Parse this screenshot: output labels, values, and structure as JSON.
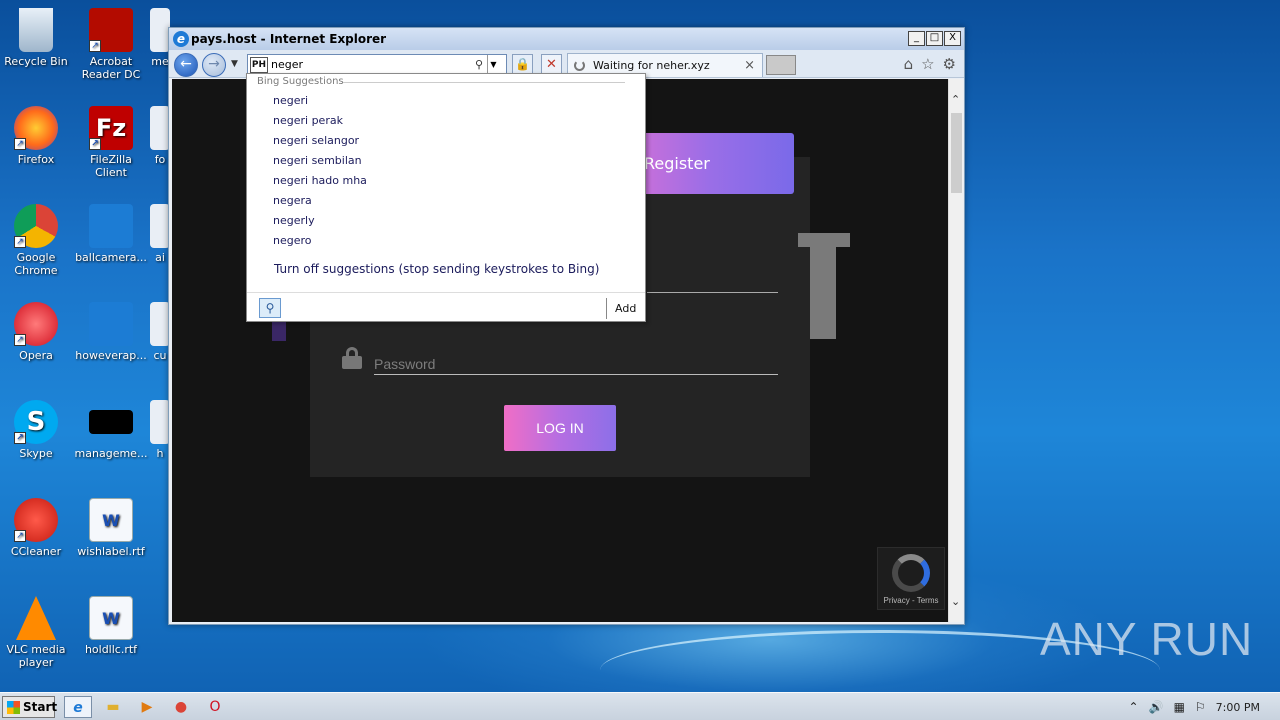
{
  "desktop": {
    "icons": [
      {
        "label": "Recycle Bin"
      },
      {
        "label": "Acrobat Reader DC"
      },
      {
        "label": "me"
      },
      {
        "label": "Firefox"
      },
      {
        "label": "FileZilla Client"
      },
      {
        "label": "fo"
      },
      {
        "label": "Google Chrome"
      },
      {
        "label": "ballcamera..."
      },
      {
        "label": "ai"
      },
      {
        "label": "Opera"
      },
      {
        "label": "howeverap..."
      },
      {
        "label": "cu"
      },
      {
        "label": "Skype"
      },
      {
        "label": "manageme..."
      },
      {
        "label": "h"
      },
      {
        "label": "CCleaner"
      },
      {
        "label": "wishlabel.rtf"
      },
      {
        "label": "VLC media player"
      },
      {
        "label": "holdllc.rtf"
      }
    ],
    "watermark": "ANY RUN"
  },
  "window": {
    "title": "pays.host - Internet Explorer",
    "controls": {
      "minimize": "_",
      "maximize": "□",
      "close": "X"
    },
    "address": {
      "value": "neger",
      "favicon": "PH"
    },
    "tab": {
      "label": "Waiting for neher.xyz",
      "close": "×"
    }
  },
  "page": {
    "register_label": "Register",
    "password_placeholder": "Password",
    "login_label": "LOG IN",
    "recaptcha_text": "Privacy - Terms"
  },
  "suggestions": {
    "header": "Bing Suggestions",
    "items": [
      "negeri",
      "negeri perak",
      "negeri selangor",
      "negeri sembilan",
      "negeri hado mha",
      "negera",
      "negerly",
      "negero"
    ],
    "turn_off": "Turn off suggestions (stop sending keystrokes to Bing)",
    "add_label": "Add"
  },
  "taskbar": {
    "start_label": "Start",
    "clock": "7:00 PM"
  }
}
